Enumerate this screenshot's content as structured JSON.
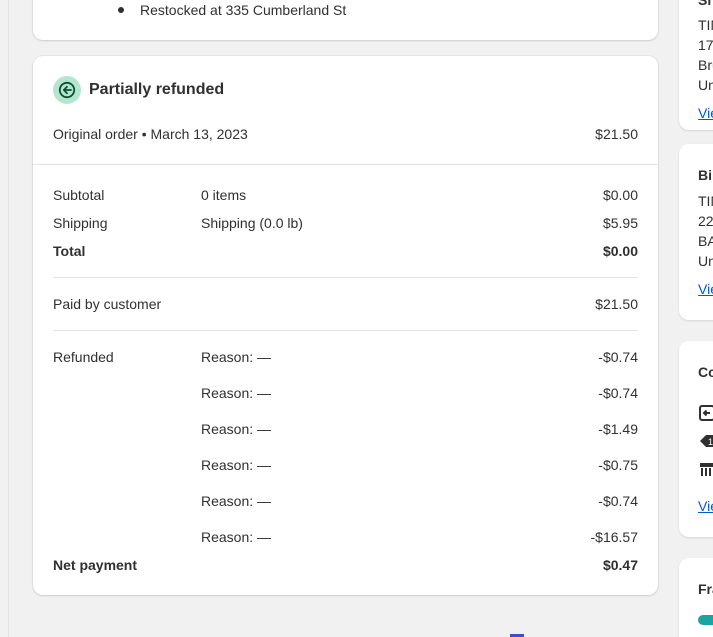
{
  "restock": {
    "text": "Restocked at 335 Cumberland St"
  },
  "refund_card": {
    "title": "Partially refunded",
    "original_order": {
      "label": "Original order • March 13, 2023",
      "value": "$21.50"
    },
    "summary": [
      {
        "label": "Subtotal",
        "detail": "0 items",
        "value": "$0.00",
        "bold": false
      },
      {
        "label": "Shipping",
        "detail": "Shipping (0.0 lb)",
        "value": "$5.95",
        "bold": false
      },
      {
        "label": "Total",
        "detail": "",
        "value": "$0.00",
        "bold": true
      }
    ],
    "paid": {
      "label": "Paid by customer",
      "value": "$21.50"
    },
    "refunded": {
      "label": "Refunded",
      "items": [
        {
          "reason": "Reason: —",
          "amount": "-$0.74"
        },
        {
          "reason": "Reason: —",
          "amount": "-$0.74"
        },
        {
          "reason": "Reason: —",
          "amount": "-$1.49"
        },
        {
          "reason": "Reason: —",
          "amount": "-$0.75"
        },
        {
          "reason": "Reason: —",
          "amount": "-$0.74"
        },
        {
          "reason": "Reason: —",
          "amount": "-$16.57"
        }
      ]
    },
    "net_payment": {
      "label": "Net payment",
      "value": "$0.47"
    }
  },
  "right_column": {
    "shipping_card": {
      "heading": "Sh",
      "lines": [
        "TIN",
        "17",
        "Bru",
        "Un"
      ],
      "link": "Vie"
    },
    "billing_card": {
      "heading": "Bil",
      "lines": [
        "TIN",
        "22",
        "BA",
        "Un"
      ],
      "link": "Vie"
    },
    "conversion_card": {
      "heading": "Co",
      "link": "Vie"
    },
    "fraud_card": {
      "heading": "Fra"
    }
  },
  "colors": {
    "accent_green": "#b4e6cf",
    "icon_green": "#0c5132",
    "link_blue": "#005bd3",
    "teal": "#1ca3a3"
  }
}
